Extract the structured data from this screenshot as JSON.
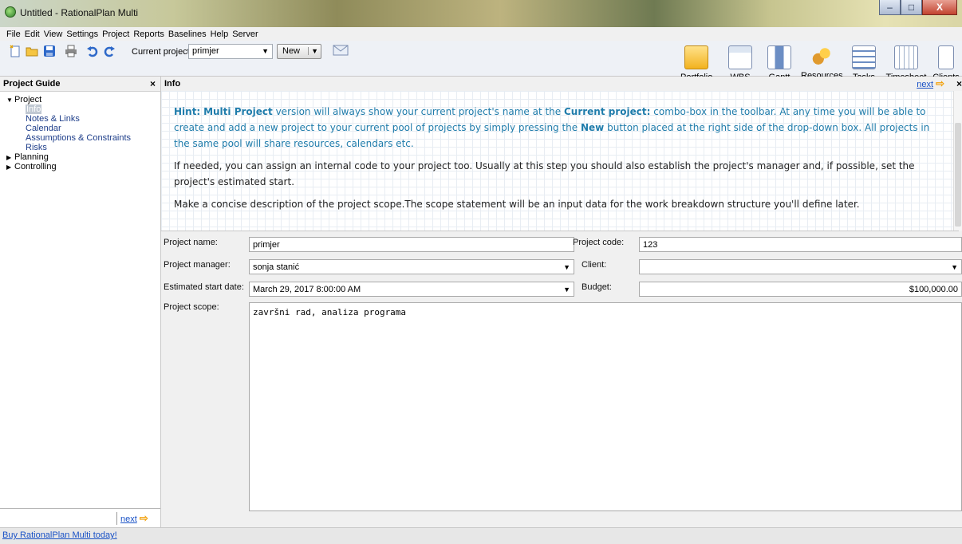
{
  "window": {
    "title": "Untitled - RationalPlan Multi",
    "minimize": "–",
    "maximize": "□",
    "close": "X"
  },
  "menu": [
    "File",
    "Edit",
    "View",
    "Settings",
    "Project",
    "Reports",
    "Baselines",
    "Help",
    "Server"
  ],
  "toolbar": {
    "current_project_label": "Current project:",
    "current_project_value": "primjer",
    "new_label": "New",
    "tools": [
      "Portfolio",
      "WBS",
      "Gantt",
      "Resources",
      "Tasks",
      "Timesheet",
      "Clients"
    ]
  },
  "guide": {
    "title": "Project Guide",
    "close": "×",
    "tree": {
      "project": "Project",
      "info": "Info",
      "notes": "Notes & Links",
      "calendar": "Calendar",
      "assumptions": "Assumptions & Constraints",
      "risks": "Risks",
      "planning": "Planning",
      "controlling": "Controlling"
    },
    "next": "next"
  },
  "info": {
    "title": "Info",
    "next": "next",
    "close": "×",
    "hint_label": "Hint:",
    "hint_product": "Multi Project",
    "hint_text_1": "version will always show your current project's name at the",
    "hint_current": "Current project:",
    "hint_text_2": "combo-box in the toolbar. At any time you will be able to create and add a new project to your current pool of projects by simply pressing the",
    "hint_new": "New",
    "hint_text_3": "button placed at the right side of the drop-down box. All projects in the same pool will share resources, calendars etc.",
    "para_2": "If needed, you can assign an internal code to your project too. Usually at this step you should also establish the project's manager and, if possible, set the project's estimated start.",
    "para_3": "Make a concise description of the project scope.The scope statement will be an input data for the work breakdown structure you'll define later."
  },
  "form": {
    "project_name_label": "Project name:",
    "project_name": "primjer",
    "project_code_label": "Project code:",
    "project_code": "123",
    "project_manager_label": "Project manager:",
    "project_manager": "sonja stanić",
    "client_label": "Client:",
    "client": "",
    "start_date_label": "Estimated start date:",
    "start_date": "March 29, 2017 8:00:00 AM",
    "budget_label": "Budget:",
    "budget": "$100,000.00",
    "scope_label": "Project scope:",
    "scope": "završni rad, analiza programa"
  },
  "status": {
    "buy_link": "Buy RationalPlan Multi today!"
  }
}
